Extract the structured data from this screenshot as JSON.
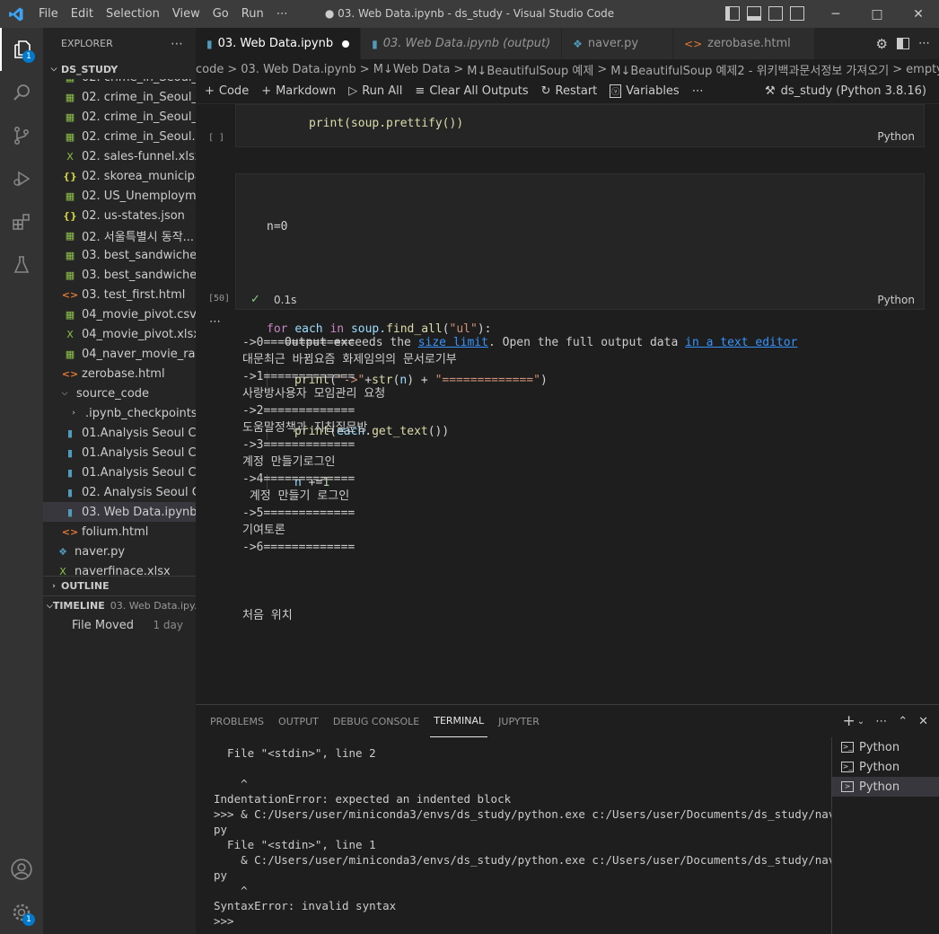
{
  "titlebar": {
    "menu": [
      "File",
      "Edit",
      "Selection",
      "View",
      "Go",
      "Run",
      "⋯"
    ],
    "title": "● 03. Web Data.ipynb - ds_study - Visual Studio Code"
  },
  "activity": {
    "explorer_badge": "1",
    "manage_badge": "1"
  },
  "sidebar": {
    "title": "EXPLORER",
    "project": "DS_STUDY",
    "files": [
      {
        "name": "02. crime_in_Seoul_...",
        "type": "csv",
        "indent": 1
      },
      {
        "name": "02. crime_in_Seoul_l...",
        "type": "csv",
        "indent": 1
      },
      {
        "name": "02. crime_in_Seoul_r...",
        "type": "csv",
        "indent": 1
      },
      {
        "name": "02. crime_in_Seoul.csv",
        "type": "csv",
        "indent": 1
      },
      {
        "name": "02. sales-funnel.xlsx",
        "type": "xlsx",
        "indent": 1
      },
      {
        "name": "02. skorea_municipa...",
        "type": "json",
        "indent": 1
      },
      {
        "name": "02. US_Unemploym...",
        "type": "csv",
        "indent": 1
      },
      {
        "name": "02. us-states.json",
        "type": "json",
        "indent": 1
      },
      {
        "name": "02. 서울특별시 동작...",
        "type": "csv",
        "indent": 1
      },
      {
        "name": "03. best_sandwiches...",
        "type": "csv",
        "indent": 1
      },
      {
        "name": "03. best_sandwiches...",
        "type": "csv",
        "indent": 1
      },
      {
        "name": "03. test_first.html",
        "type": "html",
        "indent": 1
      },
      {
        "name": "04_movie_pivot.csv",
        "type": "csv",
        "indent": 1
      },
      {
        "name": "04_movie_pivot.xlsx",
        "type": "xlsx",
        "indent": 1
      },
      {
        "name": "04_naver_movie_raw...",
        "type": "csv",
        "indent": 1
      },
      {
        "name": "zerobase.html",
        "type": "html",
        "indent": 1
      },
      {
        "name": "source_code",
        "type": "folder-open",
        "indent": 0
      },
      {
        "name": ".ipynb_checkpoints",
        "type": "folder",
        "indent": 1
      },
      {
        "name": "01.Analysis Seoul CC...",
        "type": "nb",
        "indent": 1
      },
      {
        "name": "01.Analysis Seoul CC...",
        "type": "nb",
        "indent": 1
      },
      {
        "name": "01.Analysis Seoul CC...",
        "type": "nb",
        "indent": 1
      },
      {
        "name": "02. Analysis Seoul Cr...",
        "type": "nb",
        "indent": 1
      },
      {
        "name": "03. Web Data.ipynb",
        "type": "nb",
        "indent": 1,
        "selected": true
      },
      {
        "name": "folium.html",
        "type": "html",
        "indent": 1
      },
      {
        "name": "naver.py",
        "type": "py",
        "indent": 0
      },
      {
        "name": "naverfinace.xlsx",
        "type": "xlsx",
        "indent": 0
      }
    ],
    "outline_label": "OUTLINE",
    "timeline_label": "TIMELINE",
    "timeline_file": "03. Web Data.ipy...",
    "timeline_item": "File Moved",
    "timeline_date": "1 day"
  },
  "tabs": [
    {
      "label": "03. Web Data.ipynb",
      "icon": "notebook-icon",
      "active": true,
      "dirty": true
    },
    {
      "label": "03. Web Data.ipynb (output)",
      "icon": "notebook-icon",
      "italic": true
    },
    {
      "label": "naver.py",
      "icon": "python-icon"
    },
    {
      "label": "zerobase.html",
      "icon": "html-icon"
    }
  ],
  "breadcrumb": [
    "code",
    ">",
    "03. Web Data.ipynb",
    ">",
    "M↓Web Data",
    ">",
    "M↓BeautifulSoup 예제",
    ">",
    "M↓BeautifulSoup 예제2 - 위키백과문서정보 가져오기",
    ">",
    "empty cell"
  ],
  "toolbar": {
    "code": "Code",
    "markdown": "Markdown",
    "run_all": "Run All",
    "clear_outputs": "Clear All Outputs",
    "restart": "Restart",
    "variables": "Variables",
    "more": "⋯",
    "kernel": "ds_study (Python 3.8.16)"
  },
  "cell1": {
    "exec": "[ ]",
    "lang": "Python",
    "code_partial": "print(soup.prettify())"
  },
  "cell2": {
    "exec": "[50]",
    "time": "0.1s",
    "lang": "Python",
    "line1": "n=0",
    "l2_for": "for",
    "l2_each": "each",
    "l2_in": "in",
    "l2_soup": "soup.",
    "l2_find": "find_all",
    "l2_open": "(",
    "l2_str": "\"ul\"",
    "l2_close": "):",
    "l3_print": "print",
    "l3_open": "(",
    "l3_str1": "\"->\"",
    "l3_plus": "+",
    "l3_strf": "str",
    "l3_p2": "(",
    "l3_n": "n",
    "l3_p3": ") + ",
    "l3_str2": "\"=============\"",
    "l3_close": ")",
    "l4_print": "print",
    "l4_open": "(",
    "l4_each": "each",
    "l4_get": ".get_text",
    "l4_close": "())",
    "l5_n": "n",
    "l5_op": " +=",
    "l5_num": "1"
  },
  "output": {
    "prefix": "Output exceeds the ",
    "link1": "size limit",
    "middle": ". Open the full output data ",
    "link2": "in a text editor",
    "lines": [
      "->0=============",
      "대문최근 바뀜요즘 화제임의의 문서로기부",
      "->1=============",
      "사랑방사용자 모임관리 요청",
      "->2=============",
      "도움말정책과 지침질문방",
      "->3=============",
      "계정 만들기로그인",
      "->4=============",
      " 계정 만들기 로그인",
      "->5=============",
      "기여토론",
      "->6=============",
      "",
      "",
      "",
      "처음 위치"
    ]
  },
  "panel": {
    "tabs": [
      "PROBLEMS",
      "OUTPUT",
      "DEBUG CONSOLE",
      "TERMINAL",
      "JUPYTER"
    ],
    "active_tab": "TERMINAL",
    "terminal_lines": [
      "  File \"<stdin>\", line 2",
      "",
      "    ^",
      "IndentationError: expected an indented block",
      ">>> & C:/Users/user/miniconda3/envs/ds_study/python.exe c:/Users/user/Documents/ds_study/naver.",
      "py",
      "  File \"<stdin>\", line 1",
      "    & C:/Users/user/miniconda3/envs/ds_study/python.exe c:/Users/user/Documents/ds_study/naver.",
      "py",
      "    ^",
      "SyntaxError: invalid syntax",
      ">>>"
    ],
    "terminals": [
      "Python",
      "Python",
      "Python"
    ]
  }
}
